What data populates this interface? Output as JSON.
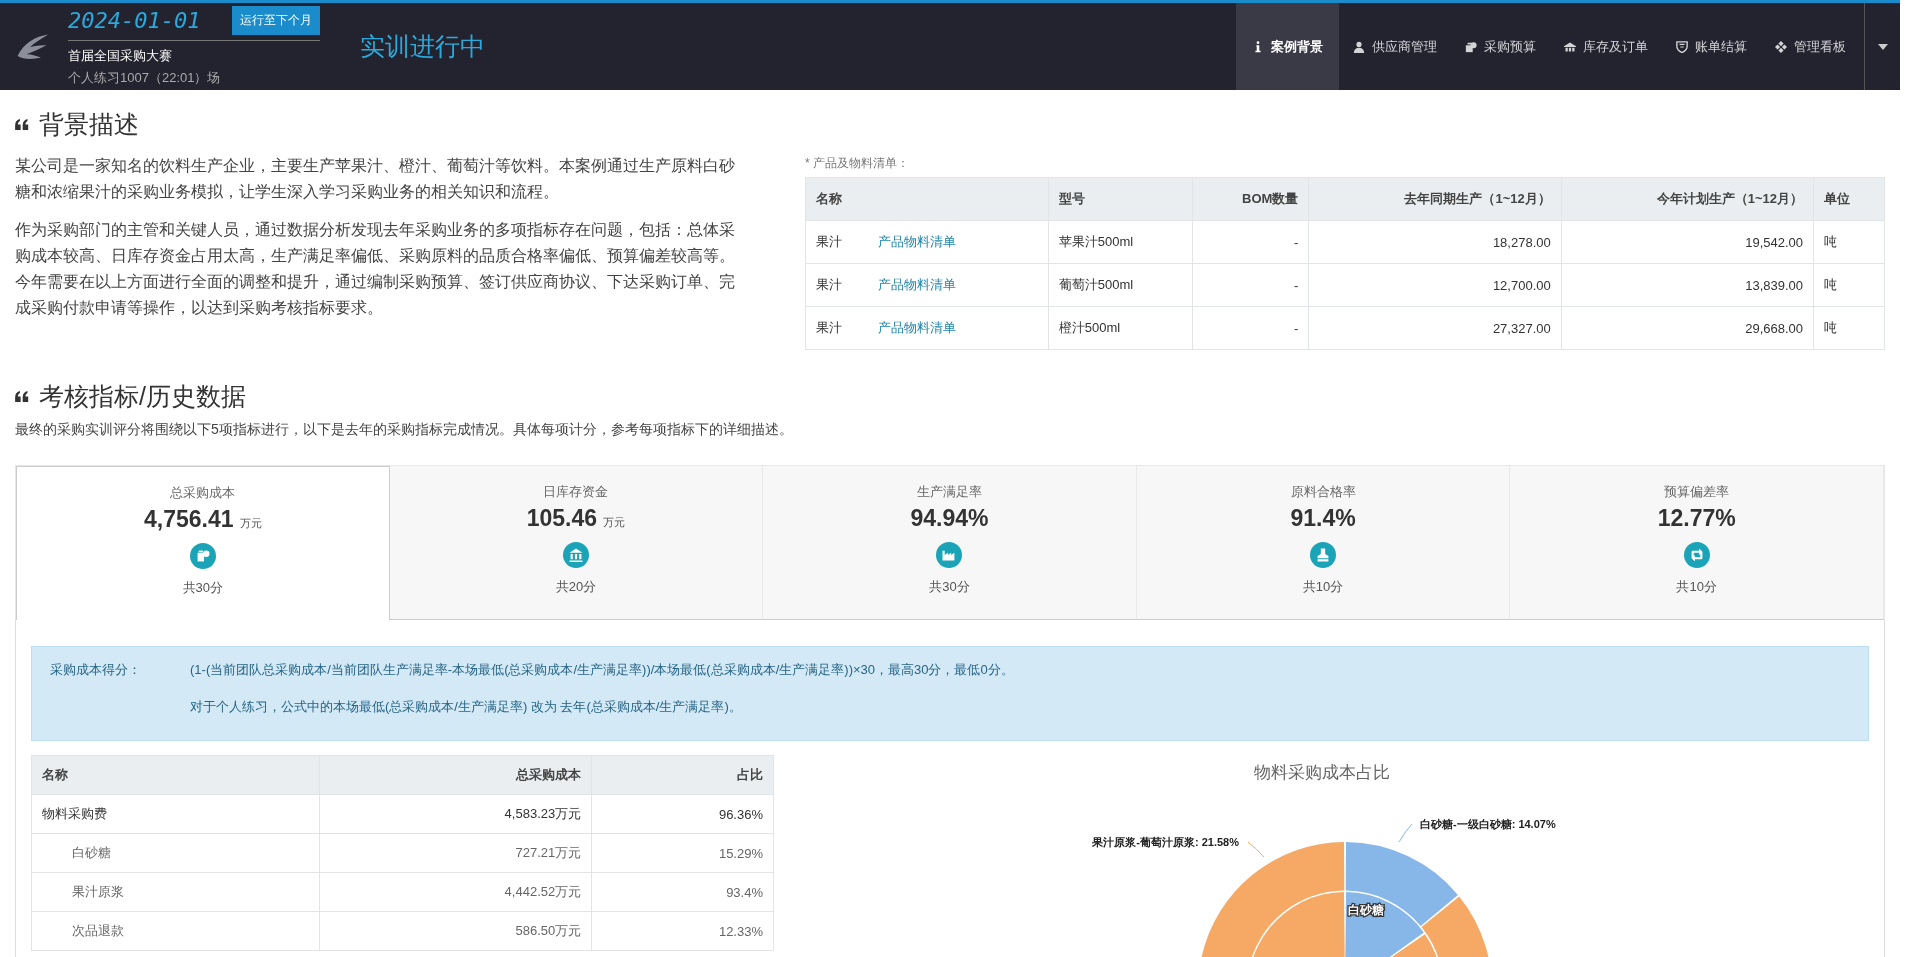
{
  "header": {
    "date": "2024-01-01",
    "advance_button": "运行至下个月",
    "contest": "首届全国采购大赛",
    "session": "个人练习1007（22:01）场",
    "status": "实训进行中"
  },
  "nav": [
    {
      "label": "案例背景",
      "kind": "info",
      "selected": true
    },
    {
      "label": "供应商管理",
      "kind": "user",
      "selected": false
    },
    {
      "label": "采购预算",
      "kind": "money",
      "selected": false
    },
    {
      "label": "库存及订单",
      "kind": "warehouse",
      "selected": false
    },
    {
      "label": "账单结算",
      "kind": "shield",
      "selected": false
    },
    {
      "label": "管理看板",
      "kind": "diamond",
      "selected": false
    }
  ],
  "background": {
    "title": "背景描述",
    "paragraphs": [
      "某公司是一家知名的饮料生产企业，主要生产苹果汁、橙汁、葡萄汁等饮料。本案例通过生产原料白砂糖和浓缩果汁的采购业务模拟，让学生深入学习采购业务的相关知识和流程。",
      "作为采购部门的主管和关键人员，通过数据分析发现去年采购业务的多项指标存在问题，包括：总体采购成本较高、日库存资金占用太高，生产满足率偏低、采购原料的品质合格率偏低、预算偏差较高等。今年需要在以上方面进行全面的调整和提升，通过编制采购预算、签订供应商协议、下达采购订单、完成采购付款申请等操作，以达到采购考核指标要求。"
    ],
    "table_note": "* 产品及物料清单：",
    "columns": [
      "名称",
      "型号",
      "BOM数量",
      "去年同期生产（1~12月）",
      "今年计划生产（1~12月）",
      "单位"
    ],
    "rows": [
      {
        "name": "果汁",
        "link": "产品物料清单",
        "model": "苹果汁500ml",
        "bom": "-",
        "last_year": "18,278.00",
        "this_year": "19,542.00",
        "unit": "吨"
      },
      {
        "name": "果汁",
        "link": "产品物料清单",
        "model": "葡萄汁500ml",
        "bom": "-",
        "last_year": "12,700.00",
        "this_year": "13,839.00",
        "unit": "吨"
      },
      {
        "name": "果汁",
        "link": "产品物料清单",
        "model": "橙汁500ml",
        "bom": "-",
        "last_year": "27,327.00",
        "this_year": "29,668.00",
        "unit": "吨"
      }
    ]
  },
  "metrics": {
    "title": "考核指标/历史数据",
    "description": "最终的采购实训评分将围绕以下5项指标进行，以下是去年的采购指标完成情况。具体每项计分，参考每项指标下的详细描述。",
    "cards": [
      {
        "label": "总采购成本",
        "value": "4,756.41",
        "unit": "万元",
        "kind": "cost",
        "score": "共30分",
        "selected": true
      },
      {
        "label": "日库存资金",
        "value": "105.46",
        "unit": "万元",
        "kind": "inventory",
        "score": "共20分",
        "selected": false
      },
      {
        "label": "生产满足率",
        "value": "94.94%",
        "kind": "production",
        "score": "共30分",
        "selected": false
      },
      {
        "label": "原料合格率",
        "value": "91.4%",
        "kind": "quality",
        "score": "共10分",
        "selected": false
      },
      {
        "label": "预算偏差率",
        "value": "12.77%",
        "kind": "budget",
        "score": "共10分",
        "selected": false
      }
    ]
  },
  "formula": {
    "label": "采购成本得分：",
    "lines": [
      "(1-(当前团队总采购成本/当前团队生产满足率-本场最低(总采购成本/生产满足率))/本场最低(总采购成本/生产满足率))×30，最高30分，最低0分。",
      "对于个人练习，公式中的本场最低(总采购成本/生产满足率) 改为 去年(总采购成本/生产满足率)。"
    ]
  },
  "cost_table": {
    "columns": [
      "名称",
      "总采购成本",
      "占比"
    ],
    "rows": [
      {
        "name": "物料采购费",
        "cost": "4,583.23万元",
        "share": "96.36%",
        "children": [
          {
            "name": "白砂糖",
            "cost": "727.21万元",
            "share": "15.29%"
          },
          {
            "name": "果汁原浆",
            "cost": "4,442.52万元",
            "share": "93.4%"
          },
          {
            "name": "次品退款",
            "cost": "586.50万元",
            "share": "12.33%"
          }
        ]
      }
    ]
  },
  "chart": {
    "title": "物料采购成本占比",
    "outer_labels": [
      "白砂糖-一级白砂糖: 14.07%",
      "果汁原浆-葡萄汁原浆: 21.58%"
    ],
    "inner_label": "白砂糖"
  }
}
